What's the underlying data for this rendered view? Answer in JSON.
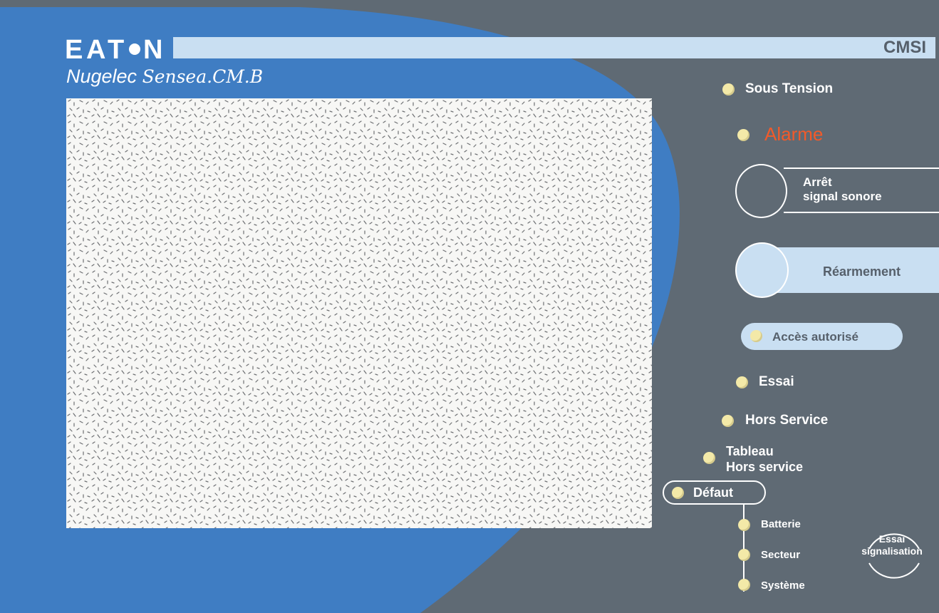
{
  "brand": {
    "logo_text": "EATON",
    "product": "Nugelec",
    "model": "Sensea.CM.B"
  },
  "header": {
    "system_code": "CMSI"
  },
  "indicators": {
    "power": "Sous Tension",
    "alarm": "Alarme",
    "access": "Accès autorisé",
    "test": "Essai",
    "out_of_service": "Hors Service",
    "panel_line1": "Tableau",
    "panel_line2": "Hors service",
    "fault": "Défaut",
    "battery": "Batterie",
    "mains": "Secteur",
    "system": "Système"
  },
  "buttons": {
    "silence_line1": "Arrêt",
    "silence_line2": "signal sonore",
    "reset": "Réarmement",
    "signal_test_line1": "Essai",
    "signal_test_line2": "signalisation"
  },
  "colors": {
    "background": "#5f6a74",
    "blue_panel": "#3f7dc3",
    "light_blue": "#c9dff2",
    "led": "#f3e9a8",
    "alarm_text": "#f25a2a"
  }
}
